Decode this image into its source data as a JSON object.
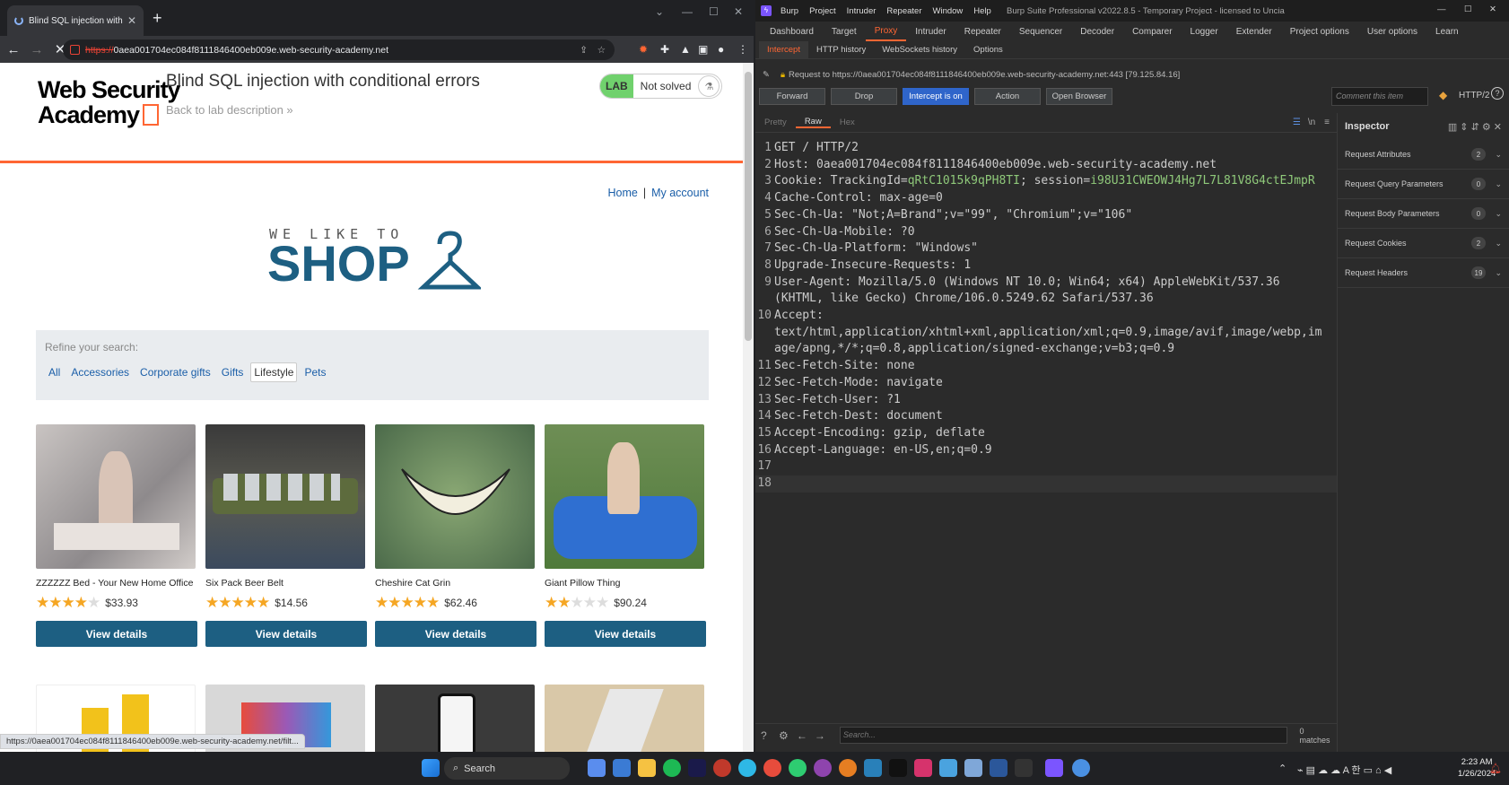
{
  "browser": {
    "tab_title": "Blind SQL injection with conditio",
    "url_scheme": "https://",
    "url_rest": "0aea001704ec084f8111846400eb009e.web-security-academy.net",
    "status_url": "https://0aea001704ec084f8111846400eb009e.web-security-academy.net/filt..."
  },
  "lab": {
    "logo_line1": "Web Security",
    "logo_line2": "Academy",
    "title": "Blind SQL injection with conditional errors",
    "back_link": "Back to lab description »",
    "badge_lab": "LAB",
    "badge_status": "Not solved"
  },
  "nav": {
    "home": "Home",
    "sep": "|",
    "account": "My account"
  },
  "shop_logo": {
    "top": "WE LIKE TO",
    "main": "SHOP"
  },
  "refine": {
    "label": "Refine your search:",
    "filters": [
      "All",
      "Accessories",
      "Corporate gifts",
      "Gifts",
      "Lifestyle",
      "Pets"
    ],
    "active": "Lifestyle"
  },
  "products": [
    {
      "name": "ZZZZZZ Bed - Your New Home Office",
      "stars": 4,
      "price": "$33.93",
      "button": "View details"
    },
    {
      "name": "Six Pack Beer Belt",
      "stars": 5,
      "price": "$14.56",
      "button": "View details"
    },
    {
      "name": "Cheshire Cat Grin",
      "stars": 5,
      "price": "$62.46",
      "button": "View details"
    },
    {
      "name": "Giant Pillow Thing",
      "stars": 2,
      "price": "$90.24",
      "button": "View details"
    }
  ],
  "burp": {
    "menus": [
      "Burp",
      "Project",
      "Intruder",
      "Repeater",
      "Window",
      "Help"
    ],
    "title": "Burp Suite Professional v2022.8.5 - Temporary Project - licensed to Uncia",
    "tabs": [
      "Dashboard",
      "Target",
      "Proxy",
      "Intruder",
      "Repeater",
      "Sequencer",
      "Decoder",
      "Comparer",
      "Logger",
      "Extender",
      "Project options",
      "User options",
      "Learn"
    ],
    "active_tab": "Proxy",
    "proxy_tabs": [
      "Intercept",
      "HTTP history",
      "WebSockets history",
      "Options"
    ],
    "active_proxy_tab": "Intercept",
    "request_to": "Request to https://0aea001704ec084f8111846400eb009e.web-security-academy.net:443  [79.125.84.16]",
    "buttons": [
      "Forward",
      "Drop",
      "Intercept is on",
      "Action",
      "Open Browser"
    ],
    "comment_placeholder": "Comment this item",
    "http_version": "HTTP/2",
    "editor_tabs": [
      "Pretty",
      "Raw",
      "Hex"
    ],
    "active_editor_tab": "Raw",
    "request_lines": [
      {
        "n": "1",
        "text": "GET / HTTP/2"
      },
      {
        "n": "2",
        "text": "Host: 0aea001704ec084f8111846400eb009e.web-security-academy.net"
      },
      {
        "n": "3",
        "pre": "Cookie: TrackingId=",
        "ck1": "qRtC1015k9qPH8TI",
        "mid": "; session=",
        "ck2": "i98U31CWEOWJ4Hg7L7L81V8G4ctEJmpR"
      },
      {
        "n": "4",
        "text": "Cache-Control: max-age=0"
      },
      {
        "n": "5",
        "text": "Sec-Ch-Ua: \"Not;A=Brand\";v=\"99\", \"Chromium\";v=\"106\""
      },
      {
        "n": "6",
        "text": "Sec-Ch-Ua-Mobile: ?0"
      },
      {
        "n": "7",
        "text": "Sec-Ch-Ua-Platform: \"Windows\""
      },
      {
        "n": "8",
        "text": "Upgrade-Insecure-Requests: 1"
      },
      {
        "n": "9",
        "text": "User-Agent: Mozilla/5.0 (Windows NT 10.0; Win64; x64) AppleWebKit/537.36"
      },
      {
        "n": "",
        "text": "(KHTML, like Gecko) Chrome/106.0.5249.62 Safari/537.36"
      },
      {
        "n": "10",
        "text": "Accept:"
      },
      {
        "n": "",
        "text": "text/html,application/xhtml+xml,application/xml;q=0.9,image/avif,image/webp,im"
      },
      {
        "n": "",
        "text": "age/apng,*/*;q=0.8,application/signed-exchange;v=b3;q=0.9"
      },
      {
        "n": "11",
        "text": "Sec-Fetch-Site: none"
      },
      {
        "n": "12",
        "text": "Sec-Fetch-Mode: navigate"
      },
      {
        "n": "13",
        "text": "Sec-Fetch-User: ?1"
      },
      {
        "n": "14",
        "text": "Sec-Fetch-Dest: document"
      },
      {
        "n": "15",
        "text": "Accept-Encoding: gzip, deflate"
      },
      {
        "n": "16",
        "text": "Accept-Language: en-US,en;q=0.9"
      },
      {
        "n": "17",
        "text": ""
      },
      {
        "n": "18",
        "text": ""
      }
    ],
    "inspector_title": "Inspector",
    "inspector_sections": [
      {
        "label": "Request Attributes",
        "count": "2"
      },
      {
        "label": "Request Query Parameters",
        "count": "0"
      },
      {
        "label": "Request Body Parameters",
        "count": "0"
      },
      {
        "label": "Request Cookies",
        "count": "2"
      },
      {
        "label": "Request Headers",
        "count": "19"
      }
    ],
    "search_placeholder": "Search...",
    "matches": "0 matches"
  },
  "taskbar": {
    "search": "Search",
    "time": "2:23 AM",
    "date": "1/26/2024"
  }
}
